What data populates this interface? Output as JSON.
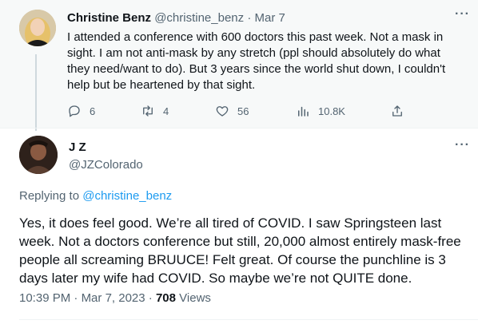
{
  "original_tweet": {
    "author_name": "Christine Benz",
    "handle": "@christine_benz",
    "separator": "·",
    "date": "Mar 7",
    "text": "I attended a conference with 600 doctors this past week. Not a mask in sight. I am not anti-mask by any stretch (ppl should absolutely do what they need/want to do). But 3 years since the world shut down, I couldn't help but be heartened by that sight.",
    "stats": {
      "replies": "6",
      "retweets": "4",
      "likes": "56",
      "views": "10.8K"
    }
  },
  "reply_tweet": {
    "author_name": "J Z",
    "handle": "@JZColorado",
    "replying_prefix": "Replying to ",
    "replying_to": "@christine_benz",
    "text": "Yes, it does feel good. We’re all tired of COVID. I saw Springsteen last week. Not a doctors conference but still, 20,000 almost entirely mask-free people all screaming BRUUCE!  Felt great. Of course the punchline is 3 days later my wife had COVID. So maybe we’re not QUITE done.",
    "time": "10:39 PM",
    "dot": "·",
    "date": "Mar 7, 2023",
    "views_count": "708",
    "views_label": "Views"
  },
  "icons": [
    "more-icon",
    "reply-icon",
    "retweet-icon",
    "like-icon",
    "views-icon",
    "share-icon"
  ],
  "colors": {
    "accent": "#1d9bf0",
    "muted": "#536471",
    "text": "#0f1419",
    "band": "#f7f9f9"
  }
}
